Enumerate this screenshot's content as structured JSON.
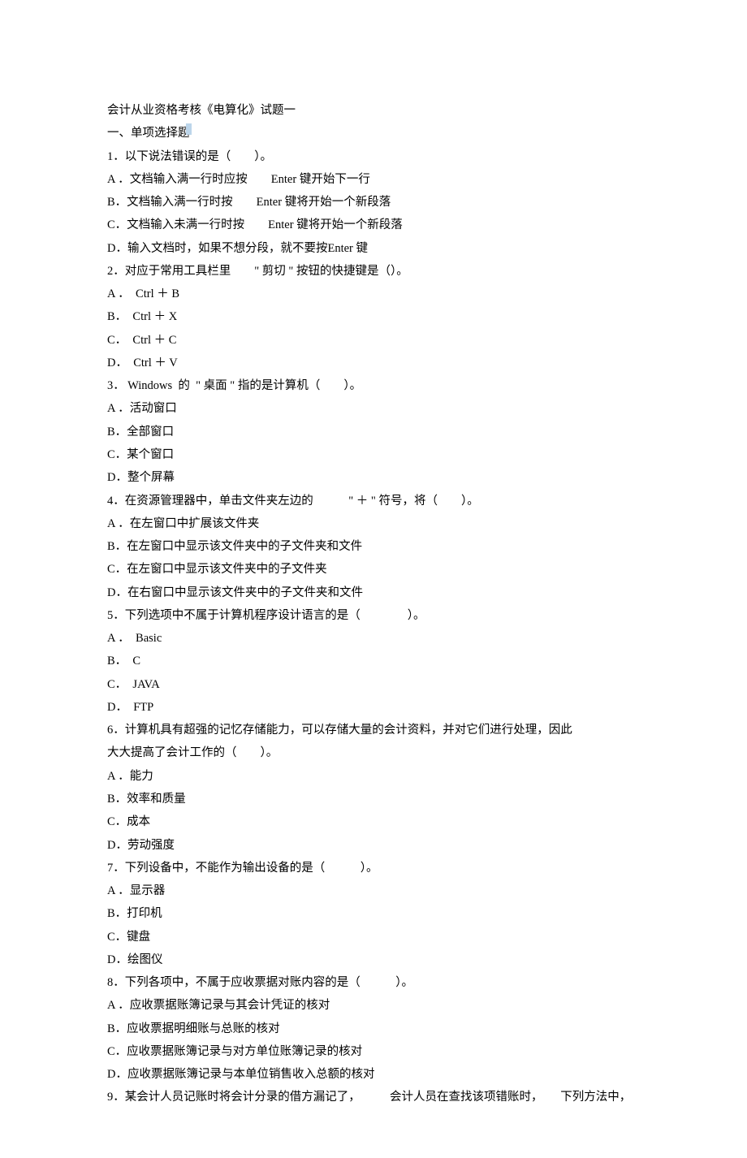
{
  "doc": {
    "title": "会计从业资格考核《电算化》试题一",
    "section1_header": "一、单项选择题",
    "q1": {
      "stem": "1．以下说法错误的是（　　）。",
      "A": "A ．文档输入满一行时应按　　Enter 键开始下一行",
      "B": "B．文档输入满一行时按　　Enter 键将开始一个新段落",
      "C": "C．文档输入未满一行时按　　Enter 键将开始一个新段落",
      "D": "D．输入文档时，如果不想分段，就不要按Enter 键"
    },
    "q2": {
      "stem": "2．对应于常用工具栏里　　\" 剪切 \" 按钮的快捷键是（）。",
      "A": "A ．  Ctrl ＋ B",
      "B": "B．  Ctrl ＋ X",
      "C": "C．  Ctrl ＋ C",
      "D": "D．  Ctrl ＋ V"
    },
    "q3": {
      "stem": "3． Windows  的  \" 桌面 \" 指的是计算机（　　）。",
      "A": "A ．活动窗口",
      "B": "B．全部窗口",
      "C": "C．某个窗口",
      "D": "D．整个屏幕"
    },
    "q4": {
      "stem": "4．在资源管理器中，单击文件夹左边的　　　\" ＋ \" 符号，将（　　）。",
      "A": "A ．在左窗口中扩展该文件夹",
      "B": "B．在左窗口中显示该文件夹中的子文件夹和文件",
      "C": "C．在左窗口中显示该文件夹中的子文件夹",
      "D": "D．在右窗口中显示该文件夹中的子文件夹和文件"
    },
    "q5": {
      "stem": "5．下列选项中不属于计算机程序设计语言的是（　　　　）。",
      "A": "A ．  Basic",
      "B": "B．  C",
      "C": "C．  JAVA",
      "D": "D．  FTP"
    },
    "q6": {
      "stem1": "6．计算机具有超强的记忆存储能力，可以存储大量的会计资料，并对它们进行处理，因此",
      "stem2": "大大提高了会计工作的（　　）。",
      "A": "A ．能力",
      "B": "B．效率和质量",
      "C": "C．成本",
      "D": "D．劳动强度"
    },
    "q7": {
      "stem": "7．下列设备中，不能作为输出设备的是（　　　）。",
      "A": "A ．显示器",
      "B": "B．打印机",
      "C": "C．键盘",
      "D": "D．绘图仪"
    },
    "q8": {
      "stem": "8．下列各项中，不属于应收票据对账内容的是（　　　）。",
      "A": "A ．应收票据账簿记录与其会计凭证的核对",
      "B": "B．应收票据明细账与总账的核对",
      "C": "C．应收票据账簿记录与对方单位账簿记录的核对",
      "D": "D．应收票据账簿记录与本单位销售收入总额的核对"
    },
    "q9": {
      "stem": "9．某会计人员记账时将会计分录的借方漏记了，　　　会计人员在查找该项错账时，　　下列方法中，"
    }
  }
}
